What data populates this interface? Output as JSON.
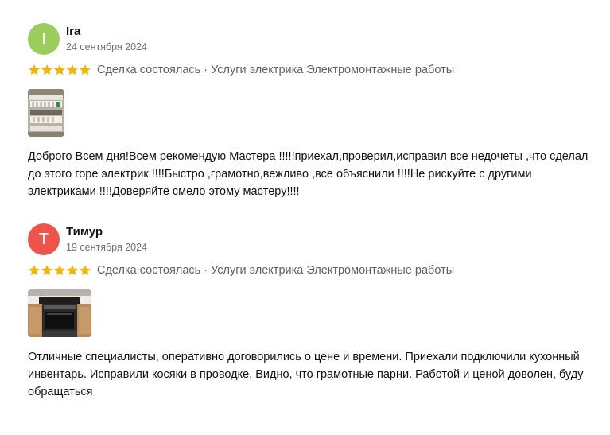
{
  "reviews": [
    {
      "avatar_letter": "I",
      "avatar_color": "#9ACD5A",
      "name": "Ira",
      "date": "24 сентября 2024",
      "stars": 5,
      "deal_text": "Сделка состоялась · Услуги электрика Электромонтажные работы",
      "text": "Доброго Всем дня!Всем рекомендую Мастера !!!!!приехал,проверил,исправил все недочеты ,что сделал до этого горе электрик !!!!Быстро ,грамотно,вежливо ,все объяснили !!!!Не рискуйте с другими электриками !!!!Доверяйте смело этому мастеру!!!!"
    },
    {
      "avatar_letter": "Т",
      "avatar_color": "#F0524C",
      "name": "Тимур",
      "date": "19 сентября 2024",
      "stars": 5,
      "deal_text": "Сделка состоялась · Услуги электрика Электромонтажные работы",
      "text": "Отличные специалисты, оперативно договорились о цене и времени. Приехали подключили кухонный инвентарь. Исправили косяки в проводке. Видно, что грамотные парни. Работой и ценой доволен, буду обращаться"
    }
  ],
  "colors": {
    "star": "#F5B400",
    "muted_text": "#707070"
  }
}
